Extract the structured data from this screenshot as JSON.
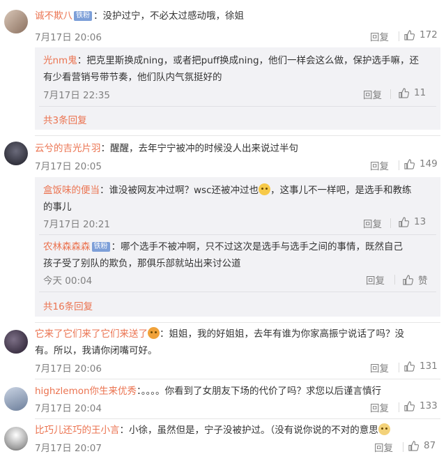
{
  "colors": {
    "username": "#eb7350",
    "meta": "#808080",
    "reply_bg": "#f2f2f5",
    "badge": "#7d9fd8"
  },
  "icons": {
    "like": "thumbs-up-icon",
    "emoji": "smiley-emoji-icon"
  },
  "comments": [
    {
      "user": "诚不欺八",
      "badge": "铁粉",
      "colon": "：",
      "text": "没护过宁，不必太过感动哦，徐姐",
      "time": "7月17日 20:06",
      "reply": "回复",
      "likes": "172",
      "replies": [
        {
          "user": "光nm鬼",
          "colon": "：",
          "line1": "把克里斯换成ning，或者把puff换成ning，他们一样会这么做，保护选手嘛，还",
          "line2": "有少看营销号带节奏，他们队内气氛挺好的",
          "time": "7月17日 22:35",
          "reply": "回复",
          "likes": "11"
        }
      ],
      "more": "共3条回复"
    },
    {
      "user": "云兮的吉光片羽",
      "colon": "：",
      "text": "醒醒，去年宁宁被冲的时候没人出来说过半句",
      "time": "7月17日 20:05",
      "reply": "回复",
      "likes": "149",
      "replies": [
        {
          "user": "盒饭味的便当",
          "colon": "：",
          "line1a": "谁没被网友冲过啊？wsc还被冲过也",
          "line1b": "，这事儿不一样吧，是选手和教练",
          "line2": "的事儿",
          "time": "7月17日 20:21",
          "reply": "回复",
          "likes": "13"
        },
        {
          "user": "农林森森森",
          "badge": "铁粉",
          "colon": "：",
          "line1": "哪个选手不被冲啊，只不过这次是选手与选手之间的事情，既然自己",
          "line2": "孩子受了别队的欺负，那俱乐部就站出来讨公道",
          "time": "今天 00:04",
          "reply": "回复",
          "likes": "赞"
        }
      ],
      "more": "共16条回复"
    },
    {
      "user": "它来了它们来了它们来送了",
      "colon": "：",
      "line1": "姐姐，我的好姐姐，去年有谁为你家高振宁说话了吗？没",
      "line2": "有。所以，我请你闭嘴可好。",
      "time": "7月17日 20:06",
      "reply": "回复",
      "likes": "131"
    },
    {
      "user": "highzlemon你生来优秀",
      "colon": "：",
      "text": "。。。。你看到了女朋友下场的代价了吗？求您以后谨言慎行",
      "time": "7月17日 20:04",
      "reply": "回复",
      "likes": "133"
    },
    {
      "user": "比巧儿还巧的王小言",
      "colon": "：",
      "text": "小徐，虽然但是，宁子没被护过。（没有说你说的不对的意思",
      "time": "7月17日 20:07",
      "reply": "回复",
      "likes": "87"
    }
  ]
}
